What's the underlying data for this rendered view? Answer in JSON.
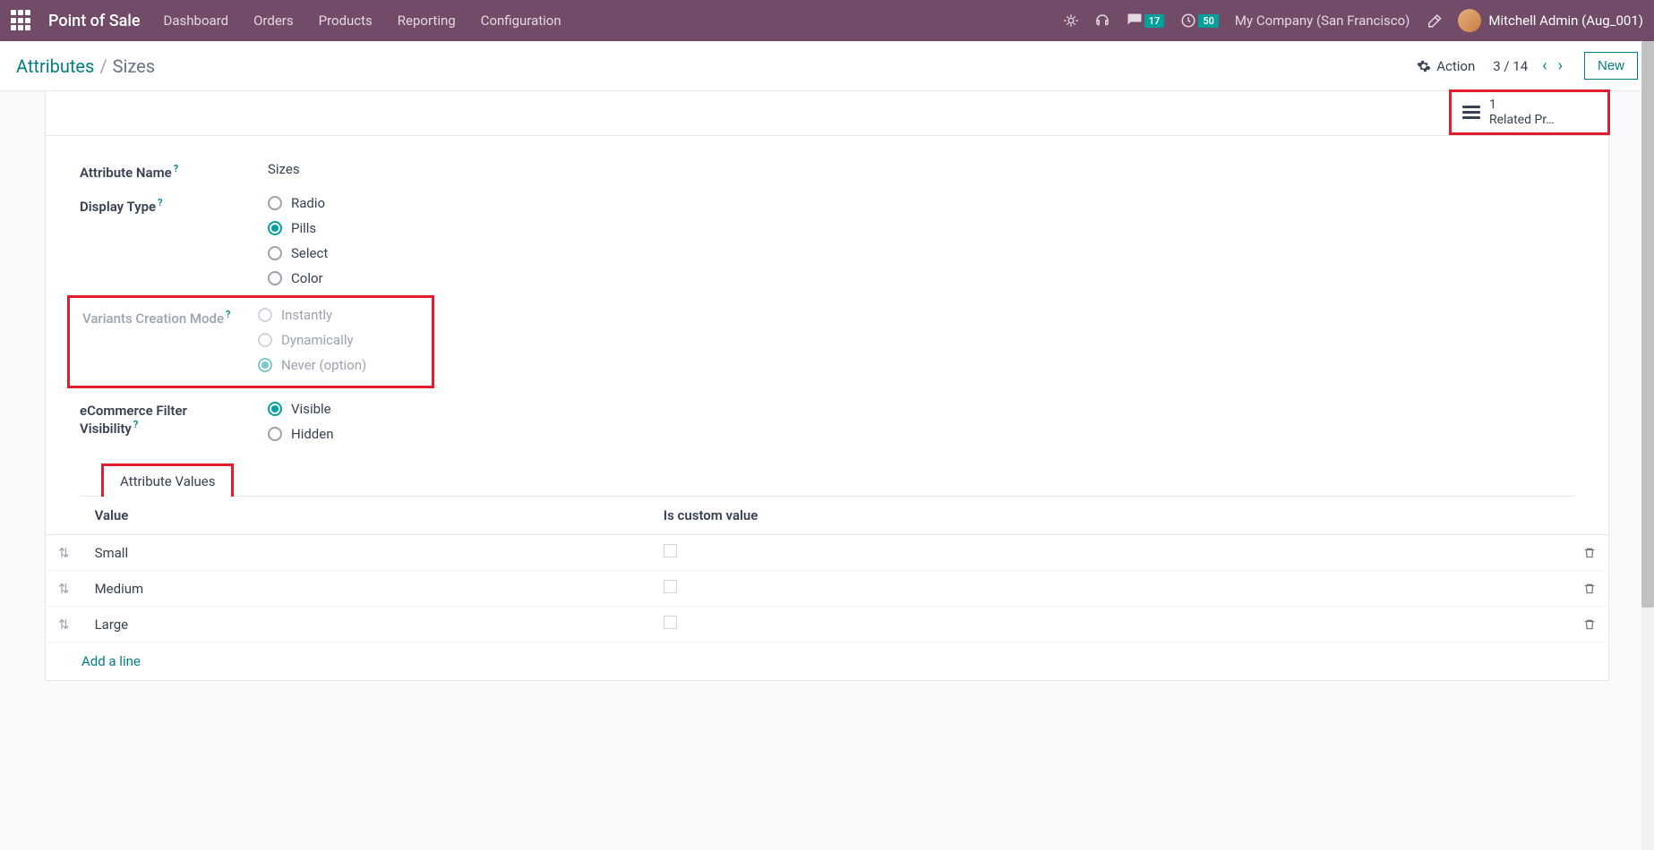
{
  "topnav": {
    "brand": "Point of Sale",
    "menu": [
      "Dashboard",
      "Orders",
      "Products",
      "Reporting",
      "Configuration"
    ],
    "messages_badge": "17",
    "activities_badge": "50",
    "company": "My Company (San Francisco)",
    "user": "Mitchell Admin (Aug_001)"
  },
  "breadcrumb": {
    "parent": "Attributes",
    "current": "Sizes"
  },
  "controlbar": {
    "action_label": "Action",
    "pager": "3 / 14",
    "new_label": "New"
  },
  "stat": {
    "count": "1",
    "label": "Related Pr…"
  },
  "form": {
    "attribute_name_label": "Attribute Name",
    "attribute_name_value": "Sizes",
    "display_type_label": "Display Type",
    "display_type_options": [
      "Radio",
      "Pills",
      "Select",
      "Color"
    ],
    "display_type_selected": "Pills",
    "variants_label": "Variants Creation Mode",
    "variants_options": [
      "Instantly",
      "Dynamically",
      "Never (option)"
    ],
    "variants_selected": "Never (option)",
    "ecommerce_label_l1": "eCommerce Filter",
    "ecommerce_label_l2": "Visibility",
    "ecommerce_options": [
      "Visible",
      "Hidden"
    ],
    "ecommerce_selected": "Visible"
  },
  "tab_label": "Attribute Values",
  "table": {
    "col_value": "Value",
    "col_custom": "Is custom value",
    "rows": [
      {
        "value": "Small"
      },
      {
        "value": "Medium"
      },
      {
        "value": "Large"
      }
    ],
    "add_line": "Add a line"
  }
}
